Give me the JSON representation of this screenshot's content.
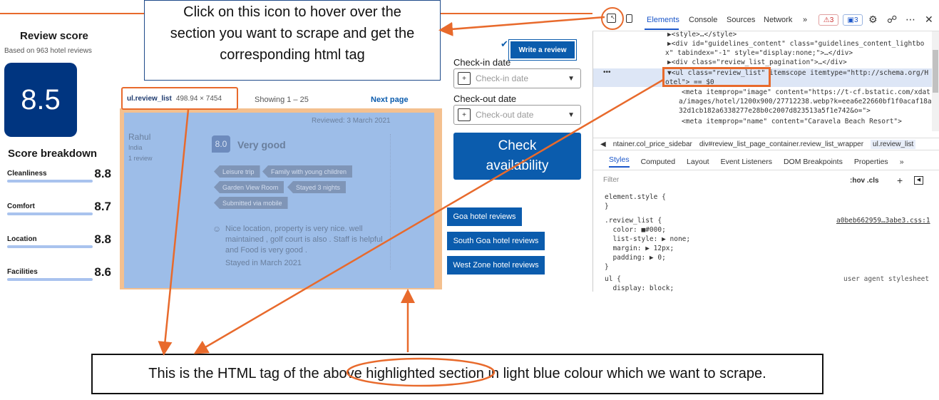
{
  "annotations": {
    "top_callout": [
      "Click on this icon to hover over the",
      "section you want to scrape and get the",
      "corresponding html tag"
    ],
    "bottom_callout": "This is the HTML tag of the above highlighted section in light blue colour which we want to scrape."
  },
  "review_score": {
    "title": "Review score",
    "subtitle": "Based on 963 hotel reviews",
    "score": "8.5",
    "breakdown_title": "Score breakdown",
    "breakdown": [
      {
        "label": "Cleanliness",
        "value": "8.8"
      },
      {
        "label": "Comfort",
        "value": "8.7"
      },
      {
        "label": "Location",
        "value": "8.8"
      },
      {
        "label": "Facilities",
        "value": "8.6"
      }
    ]
  },
  "highlight": {
    "element_name": "ul.review_list",
    "element_size": "498.94 × 7454",
    "showing": "Showing 1 – 25",
    "next_page": "Next page"
  },
  "review": {
    "reviewed_date": "Reviewed: 3 March 2021",
    "reviewer_name": "Rahul",
    "reviewer_country": "India",
    "reviewer_count": "1 review",
    "score": "8.0",
    "rating_word": "Very good",
    "tags": [
      "Leisure trip",
      "Family with young children",
      "Garden View Room",
      "Stayed 3 nights",
      "Submitted via mobile"
    ],
    "text": "Nice location, property is very nice. well maintained , golf court is also . Staff  is helpful  and  Food is very good .",
    "stayed": "Stayed in March 2021"
  },
  "booking": {
    "write_review": "Write a review",
    "checkin_label": "Check-in date",
    "checkin_placeholder": "Check-in date",
    "checkout_label": "Check-out date",
    "checkout_placeholder": "Check-out date",
    "check_button_line1": "Check",
    "check_button_line2": "availability",
    "links": [
      "Goa hotel reviews",
      "South Goa hotel reviews",
      "West Zone hotel reviews"
    ]
  },
  "devtools": {
    "tabs": [
      "Elements",
      "Console",
      "Sources",
      "Network",
      "»"
    ],
    "warn_count": "3",
    "info_count": "3",
    "dom_lines": [
      "▶<style>…</style>",
      "▶<div id=\"guidelines_content\" class=\"guidelines_content_lightbo",
      "x\" tabindex=\"-1\" style=\"display:none;\">…</div>",
      "▶<div class=\"review_list_pagination\">…</div>",
      "▼<ul class=\"review_list\" itemscope itemtype=\"http://schema.org/H",
      "otel\"> == $0",
      "<meta itemprop=\"image\" content=\"https://t-cf.bstatic.com/xdat",
      "a/images/hotel/1200x900/27712238.webp?k=eea6e22660bf1f0acaf18a",
      "32d1cb182a6338277e28b0c2007d823513a5f1e742&o=\">",
      "<meta itemprop=\"name\" content=\"Caravela Beach Resort\">",
      "<meta itemprop=\"..."
    ],
    "breadcrumbs": [
      "ntainer.col_price_sidebar",
      "div#review_list_page_container.review_list_wrapper",
      "ul.review_list"
    ],
    "panel_tabs": [
      "Styles",
      "Computed",
      "Layout",
      "Event Listeners",
      "DOM Breakpoints",
      "Properties",
      "»"
    ],
    "filter_placeholder": "Filter",
    "hov_cls": ":hov  .cls",
    "styles": [
      "element.style {",
      "}",
      ".review_list {",
      "  color: ■#000;",
      "  list-style: ▶ none;",
      "  margin: ▶ 12px;",
      "  padding: ▶ 0;",
      "}",
      "ul {",
      "  display: block;"
    ],
    "source_link": "a0beb662959…3abe3.css:1",
    "ua_label": "user agent stylesheet"
  }
}
